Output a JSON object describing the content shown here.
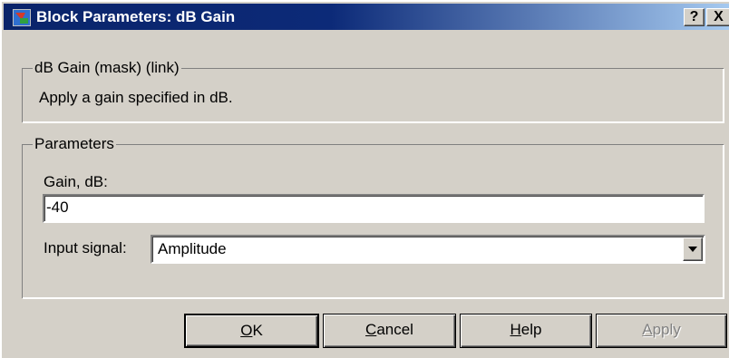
{
  "window": {
    "title": "Block Parameters: dB Gain",
    "help_button": "?",
    "close_button": "X"
  },
  "description": {
    "group_label": "dB Gain (mask) (link)",
    "text": "Apply a gain specified in dB."
  },
  "parameters": {
    "group_label": "Parameters",
    "gain_label": "Gain, dB:",
    "gain_value": "-40",
    "input_signal_label": "Input signal:",
    "input_signal_value": "Amplitude"
  },
  "buttons": {
    "ok": {
      "accel": "O",
      "rest": "K"
    },
    "cancel": {
      "accel": "C",
      "rest": "ancel"
    },
    "help": {
      "accel": "H",
      "rest": "elp"
    },
    "apply": {
      "accel": "A",
      "rest": "pply"
    }
  },
  "icons": {
    "app": "simulink-block-icon",
    "dropdown": "chevron-down-icon"
  }
}
